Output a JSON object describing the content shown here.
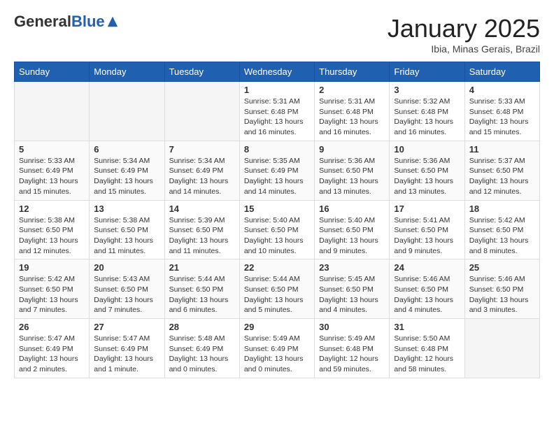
{
  "header": {
    "logo_general": "General",
    "logo_blue": "Blue",
    "month_title": "January 2025",
    "location": "Ibia, Minas Gerais, Brazil"
  },
  "weekdays": [
    "Sunday",
    "Monday",
    "Tuesday",
    "Wednesday",
    "Thursday",
    "Friday",
    "Saturday"
  ],
  "weeks": [
    [
      {
        "day": "",
        "info": ""
      },
      {
        "day": "",
        "info": ""
      },
      {
        "day": "",
        "info": ""
      },
      {
        "day": "1",
        "info": "Sunrise: 5:31 AM\nSunset: 6:48 PM\nDaylight: 13 hours\nand 16 minutes."
      },
      {
        "day": "2",
        "info": "Sunrise: 5:31 AM\nSunset: 6:48 PM\nDaylight: 13 hours\nand 16 minutes."
      },
      {
        "day": "3",
        "info": "Sunrise: 5:32 AM\nSunset: 6:48 PM\nDaylight: 13 hours\nand 16 minutes."
      },
      {
        "day": "4",
        "info": "Sunrise: 5:33 AM\nSunset: 6:48 PM\nDaylight: 13 hours\nand 15 minutes."
      }
    ],
    [
      {
        "day": "5",
        "info": "Sunrise: 5:33 AM\nSunset: 6:49 PM\nDaylight: 13 hours\nand 15 minutes."
      },
      {
        "day": "6",
        "info": "Sunrise: 5:34 AM\nSunset: 6:49 PM\nDaylight: 13 hours\nand 15 minutes."
      },
      {
        "day": "7",
        "info": "Sunrise: 5:34 AM\nSunset: 6:49 PM\nDaylight: 13 hours\nand 14 minutes."
      },
      {
        "day": "8",
        "info": "Sunrise: 5:35 AM\nSunset: 6:49 PM\nDaylight: 13 hours\nand 14 minutes."
      },
      {
        "day": "9",
        "info": "Sunrise: 5:36 AM\nSunset: 6:50 PM\nDaylight: 13 hours\nand 13 minutes."
      },
      {
        "day": "10",
        "info": "Sunrise: 5:36 AM\nSunset: 6:50 PM\nDaylight: 13 hours\nand 13 minutes."
      },
      {
        "day": "11",
        "info": "Sunrise: 5:37 AM\nSunset: 6:50 PM\nDaylight: 13 hours\nand 12 minutes."
      }
    ],
    [
      {
        "day": "12",
        "info": "Sunrise: 5:38 AM\nSunset: 6:50 PM\nDaylight: 13 hours\nand 12 minutes."
      },
      {
        "day": "13",
        "info": "Sunrise: 5:38 AM\nSunset: 6:50 PM\nDaylight: 13 hours\nand 11 minutes."
      },
      {
        "day": "14",
        "info": "Sunrise: 5:39 AM\nSunset: 6:50 PM\nDaylight: 13 hours\nand 11 minutes."
      },
      {
        "day": "15",
        "info": "Sunrise: 5:40 AM\nSunset: 6:50 PM\nDaylight: 13 hours\nand 10 minutes."
      },
      {
        "day": "16",
        "info": "Sunrise: 5:40 AM\nSunset: 6:50 PM\nDaylight: 13 hours\nand 9 minutes."
      },
      {
        "day": "17",
        "info": "Sunrise: 5:41 AM\nSunset: 6:50 PM\nDaylight: 13 hours\nand 9 minutes."
      },
      {
        "day": "18",
        "info": "Sunrise: 5:42 AM\nSunset: 6:50 PM\nDaylight: 13 hours\nand 8 minutes."
      }
    ],
    [
      {
        "day": "19",
        "info": "Sunrise: 5:42 AM\nSunset: 6:50 PM\nDaylight: 13 hours\nand 7 minutes."
      },
      {
        "day": "20",
        "info": "Sunrise: 5:43 AM\nSunset: 6:50 PM\nDaylight: 13 hours\nand 7 minutes."
      },
      {
        "day": "21",
        "info": "Sunrise: 5:44 AM\nSunset: 6:50 PM\nDaylight: 13 hours\nand 6 minutes."
      },
      {
        "day": "22",
        "info": "Sunrise: 5:44 AM\nSunset: 6:50 PM\nDaylight: 13 hours\nand 5 minutes."
      },
      {
        "day": "23",
        "info": "Sunrise: 5:45 AM\nSunset: 6:50 PM\nDaylight: 13 hours\nand 4 minutes."
      },
      {
        "day": "24",
        "info": "Sunrise: 5:46 AM\nSunset: 6:50 PM\nDaylight: 13 hours\nand 4 minutes."
      },
      {
        "day": "25",
        "info": "Sunrise: 5:46 AM\nSunset: 6:50 PM\nDaylight: 13 hours\nand 3 minutes."
      }
    ],
    [
      {
        "day": "26",
        "info": "Sunrise: 5:47 AM\nSunset: 6:49 PM\nDaylight: 13 hours\nand 2 minutes."
      },
      {
        "day": "27",
        "info": "Sunrise: 5:47 AM\nSunset: 6:49 PM\nDaylight: 13 hours\nand 1 minute."
      },
      {
        "day": "28",
        "info": "Sunrise: 5:48 AM\nSunset: 6:49 PM\nDaylight: 13 hours\nand 0 minutes."
      },
      {
        "day": "29",
        "info": "Sunrise: 5:49 AM\nSunset: 6:49 PM\nDaylight: 13 hours\nand 0 minutes."
      },
      {
        "day": "30",
        "info": "Sunrise: 5:49 AM\nSunset: 6:48 PM\nDaylight: 12 hours\nand 59 minutes."
      },
      {
        "day": "31",
        "info": "Sunrise: 5:50 AM\nSunset: 6:48 PM\nDaylight: 12 hours\nand 58 minutes."
      },
      {
        "day": "",
        "info": ""
      }
    ]
  ]
}
